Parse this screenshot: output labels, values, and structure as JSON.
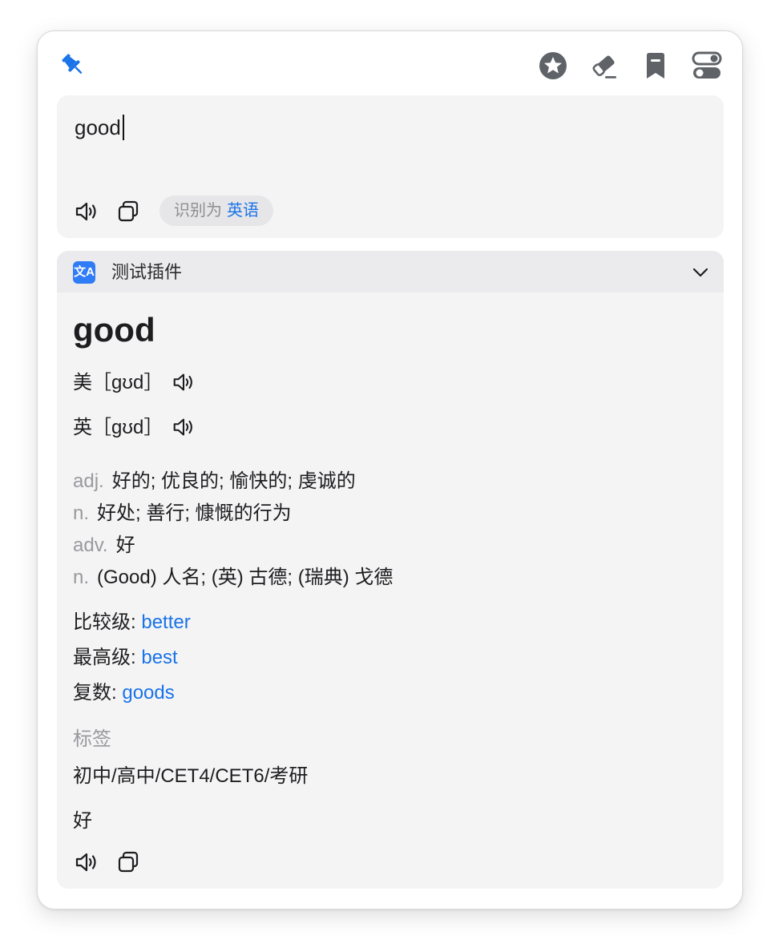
{
  "toolbar": {
    "pin_icon": "pin-icon",
    "icons": [
      "star-icon",
      "eraser-icon",
      "bookmark-icon",
      "toggle-icon"
    ],
    "accent": "#1a73e8"
  },
  "input": {
    "text": "good",
    "detect_label": "识别为",
    "detect_lang": "英语"
  },
  "plugin": {
    "name": "测试插件",
    "logo_text": "文A",
    "word": "good",
    "phonetics": [
      {
        "region": "美",
        "ipa": "［gʊd］"
      },
      {
        "region": "英",
        "ipa": "［gʊd］"
      }
    ],
    "definitions": [
      {
        "pos": "adj.",
        "meaning": "好的; 优良的; 愉快的; 虔诚的"
      },
      {
        "pos": "n.",
        "meaning": "好处; 善行; 慷慨的行为"
      },
      {
        "pos": "adv.",
        "meaning": "好"
      },
      {
        "pos": "n.",
        "meaning": "(Good) 人名; (英) 古德; (瑞典) 戈德"
      }
    ],
    "forms": [
      {
        "label": "比较级:",
        "value": "better"
      },
      {
        "label": "最高级:",
        "value": "best"
      },
      {
        "label": "复数:",
        "value": "goods"
      }
    ],
    "tags_title": "标签",
    "tags": "初中/高中/CET4/CET6/考研",
    "translation": "好"
  }
}
